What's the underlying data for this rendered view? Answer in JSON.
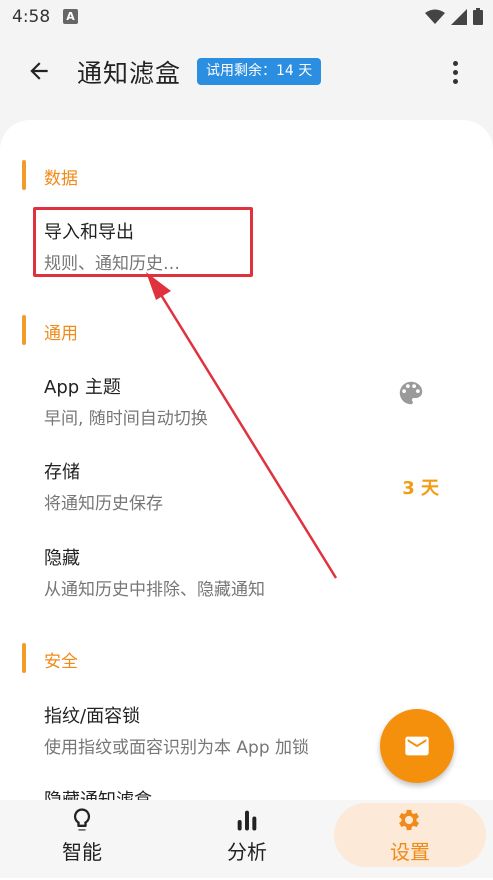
{
  "status_bar": {
    "time": "4:58",
    "notification_glyph": "A"
  },
  "app_bar": {
    "title": "通知滤盒",
    "trial_badge": "试用剩余：14 天"
  },
  "sections": {
    "data": {
      "label": "数据",
      "import_export": {
        "title": "导入和导出",
        "summary": "规则、通知历史…"
      }
    },
    "general": {
      "label": "通用",
      "theme": {
        "title": "App 主题",
        "summary": "早间, 随时间自动切换",
        "icon": "palette-icon"
      },
      "storage": {
        "title": "存储",
        "summary": "将通知历史保存",
        "value": "3 天"
      },
      "hide": {
        "title": "隐藏",
        "summary": "从通知历史中排除、隐藏通知"
      }
    },
    "security": {
      "label": "安全",
      "lock": {
        "title": "指纹/面容锁",
        "summary": "使用指纹或面容识别为本 App 加锁"
      },
      "hide_app": {
        "title": "隐藏通知滤盒"
      }
    }
  },
  "fab": {
    "icon": "mail-icon"
  },
  "bottom_nav": {
    "smart": {
      "label": "智能",
      "icon": "lightbulb-icon"
    },
    "analysis": {
      "label": "分析",
      "icon": "bar-chart-icon"
    },
    "settings": {
      "label": "设置",
      "icon": "gear-icon",
      "active": true
    }
  },
  "colors": {
    "accent": "#f08a18",
    "badge": "#2b8ee0",
    "annotation": "#e0323e",
    "fab": "#f5900d"
  }
}
